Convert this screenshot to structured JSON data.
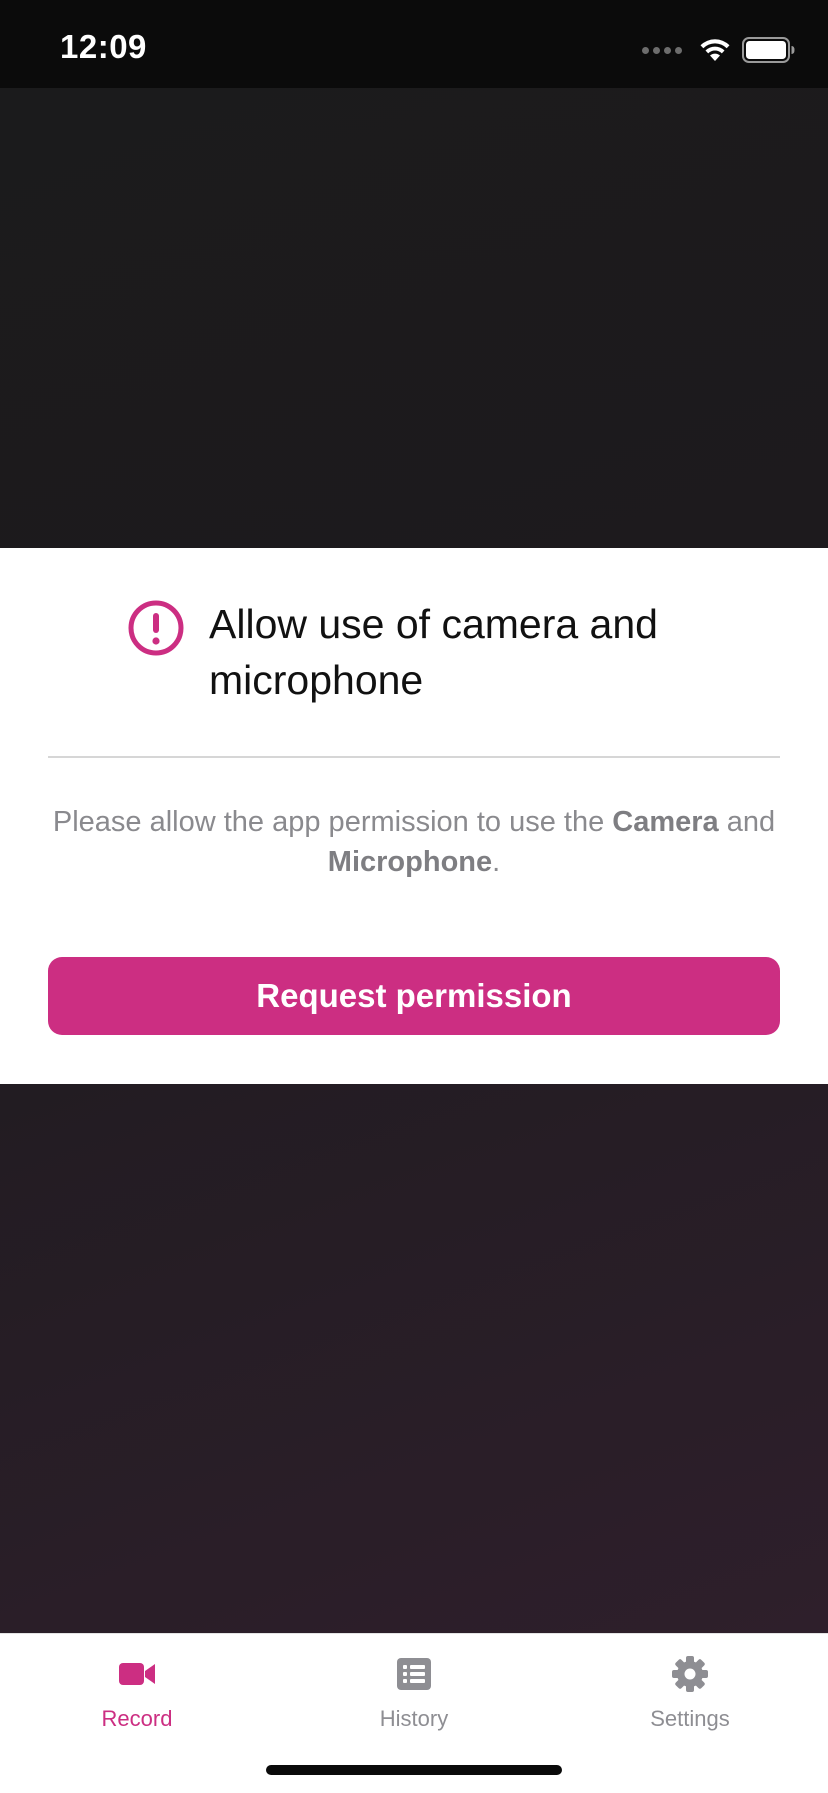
{
  "status_bar": {
    "time": "12:09"
  },
  "permission_card": {
    "icon": "alert-circle-icon",
    "title": "Allow use of camera and microphone",
    "message_prefix": "Please allow the app permission to use the ",
    "message_camera": "Camera",
    "message_middle": " and ",
    "message_microphone": "Microphone",
    "message_suffix": ".",
    "button_label": "Request permission"
  },
  "tab_bar": {
    "tabs": [
      {
        "label": "Record",
        "icon": "video-camera-icon",
        "active": true
      },
      {
        "label": "History",
        "icon": "list-icon",
        "active": false
      },
      {
        "label": "Settings",
        "icon": "gear-icon",
        "active": false
      }
    ]
  },
  "colors": {
    "accent": "#cc2e82",
    "inactive": "#8e8e93",
    "status_bar_bg": "#0b0b0b"
  }
}
